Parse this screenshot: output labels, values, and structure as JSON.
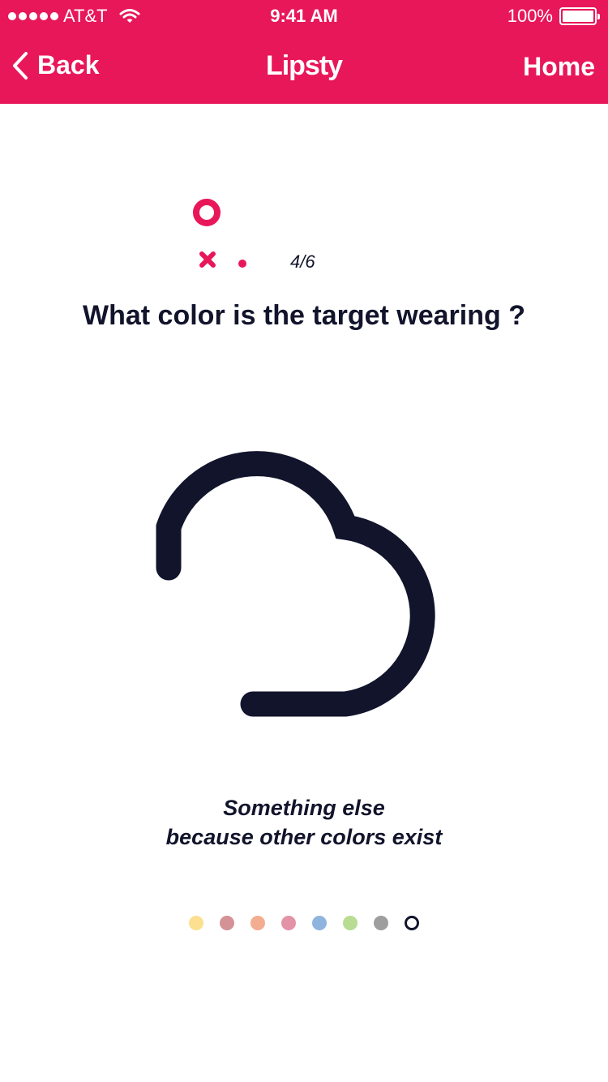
{
  "status_bar": {
    "carrier": "AT&T",
    "time": "9:41 AM",
    "battery": "100%",
    "battery_level": 1.0,
    "signal_strength": 5,
    "icons": [
      "signal-dots-icon",
      "wifi-icon",
      "battery-icon"
    ]
  },
  "nav": {
    "back_label": "Back",
    "title": "Lipsty",
    "home_label": "Home",
    "icons": [
      "chevron-left-icon"
    ]
  },
  "progress": {
    "counter": "4/6",
    "icons": [
      "progress-ring-icon",
      "wrong-answer-icon",
      "current-step-dot"
    ]
  },
  "question": "What color is the target wearing ?",
  "illustration": {
    "icon": "cloud-outline-icon"
  },
  "answer": {
    "line1": "Something else",
    "line2": "because other colors exist"
  },
  "colors": {
    "accent": "#e8175a",
    "text": "#11142b"
  },
  "swatches": [
    {
      "name": "yellow",
      "color": "#fce08f",
      "selected": false
    },
    {
      "name": "mauve",
      "color": "#d49297",
      "selected": false
    },
    {
      "name": "peach",
      "color": "#f3ad91",
      "selected": false
    },
    {
      "name": "pink",
      "color": "#e393a8",
      "selected": false
    },
    {
      "name": "blue",
      "color": "#8fb5de",
      "selected": false
    },
    {
      "name": "green",
      "color": "#b9dc93",
      "selected": false
    },
    {
      "name": "gray",
      "color": "#9e9e9e",
      "selected": false
    },
    {
      "name": "other",
      "color": "#ffffff",
      "selected": true
    }
  ]
}
